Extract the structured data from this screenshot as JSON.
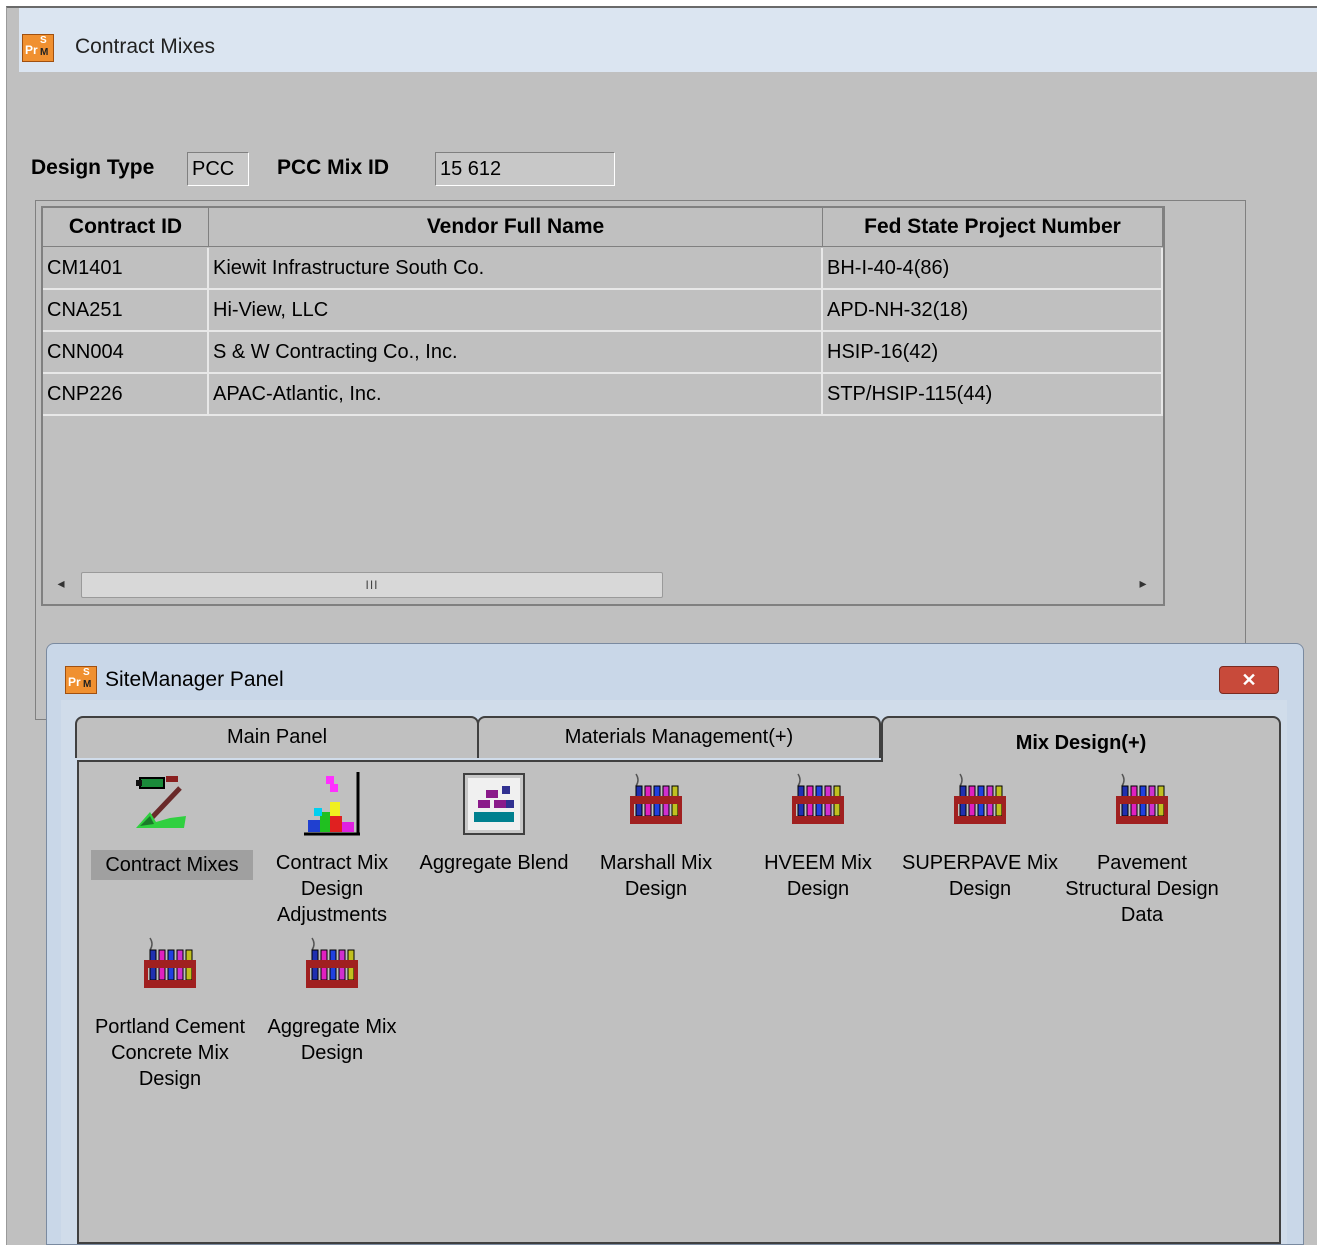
{
  "window": {
    "title": "Contract Mixes",
    "icon": "prsm-app-icon"
  },
  "fields": {
    "design_type_label": "Design Type",
    "design_type_value": "PCC",
    "mix_id_label": "PCC Mix ID",
    "mix_id_value": "15 612"
  },
  "grid": {
    "columns": [
      "Contract ID",
      "Vendor Full Name",
      "Fed State Project Number"
    ],
    "rows": [
      [
        "CM1401",
        "Kiewit Infrastructure South Co.",
        "BH-I-40-4(86)"
      ],
      [
        "CNA251",
        "Hi-View, LLC",
        "APD-NH-32(18)"
      ],
      [
        "CNN004",
        "S & W Contracting Co., Inc.",
        "HSIP-16(42)"
      ],
      [
        "CNP226",
        "APAC-Atlantic, Inc.",
        "STP/HSIP-115(44)"
      ]
    ],
    "scroll_left": "◂",
    "scroll_right": "▸",
    "scroll_thumb": "III"
  },
  "panel": {
    "title": "SiteManager Panel",
    "close_label": "✕",
    "tabs": [
      {
        "label": "Main Panel",
        "active": false
      },
      {
        "label": "Materials Management(+)",
        "active": false
      },
      {
        "label": "Mix Design(+)",
        "active": true
      }
    ],
    "tiles": [
      {
        "label": "Contract Mixes",
        "icon": "contract-mixes-icon",
        "selected": true
      },
      {
        "label": "Contract Mix Design Adjustments",
        "icon": "mix-adjustments-icon",
        "selected": false
      },
      {
        "label": "Aggregate Blend",
        "icon": "aggregate-blend-icon",
        "selected": false
      },
      {
        "label": "Marshall Mix Design",
        "icon": "test-tubes-icon",
        "selected": false
      },
      {
        "label": "HVEEM Mix Design",
        "icon": "test-tubes-icon",
        "selected": false
      },
      {
        "label": "SUPERPAVE Mix Design",
        "icon": "test-tubes-icon",
        "selected": false
      },
      {
        "label": "Pavement Structural Design Data",
        "icon": "test-tubes-icon",
        "selected": false
      },
      {
        "label": "Portland Cement Concrete Mix Design",
        "icon": "test-tubes-icon",
        "selected": false
      },
      {
        "label": "Aggregate Mix Design",
        "icon": "test-tubes-icon",
        "selected": false
      }
    ]
  },
  "colors": {
    "window_bg": "#c0c0c0",
    "titlebar_bg": "#dbe5f1",
    "panel_frame": "#c9d7e8",
    "close_button": "#c84a3a",
    "selected_tile": "#a0a0a0"
  }
}
